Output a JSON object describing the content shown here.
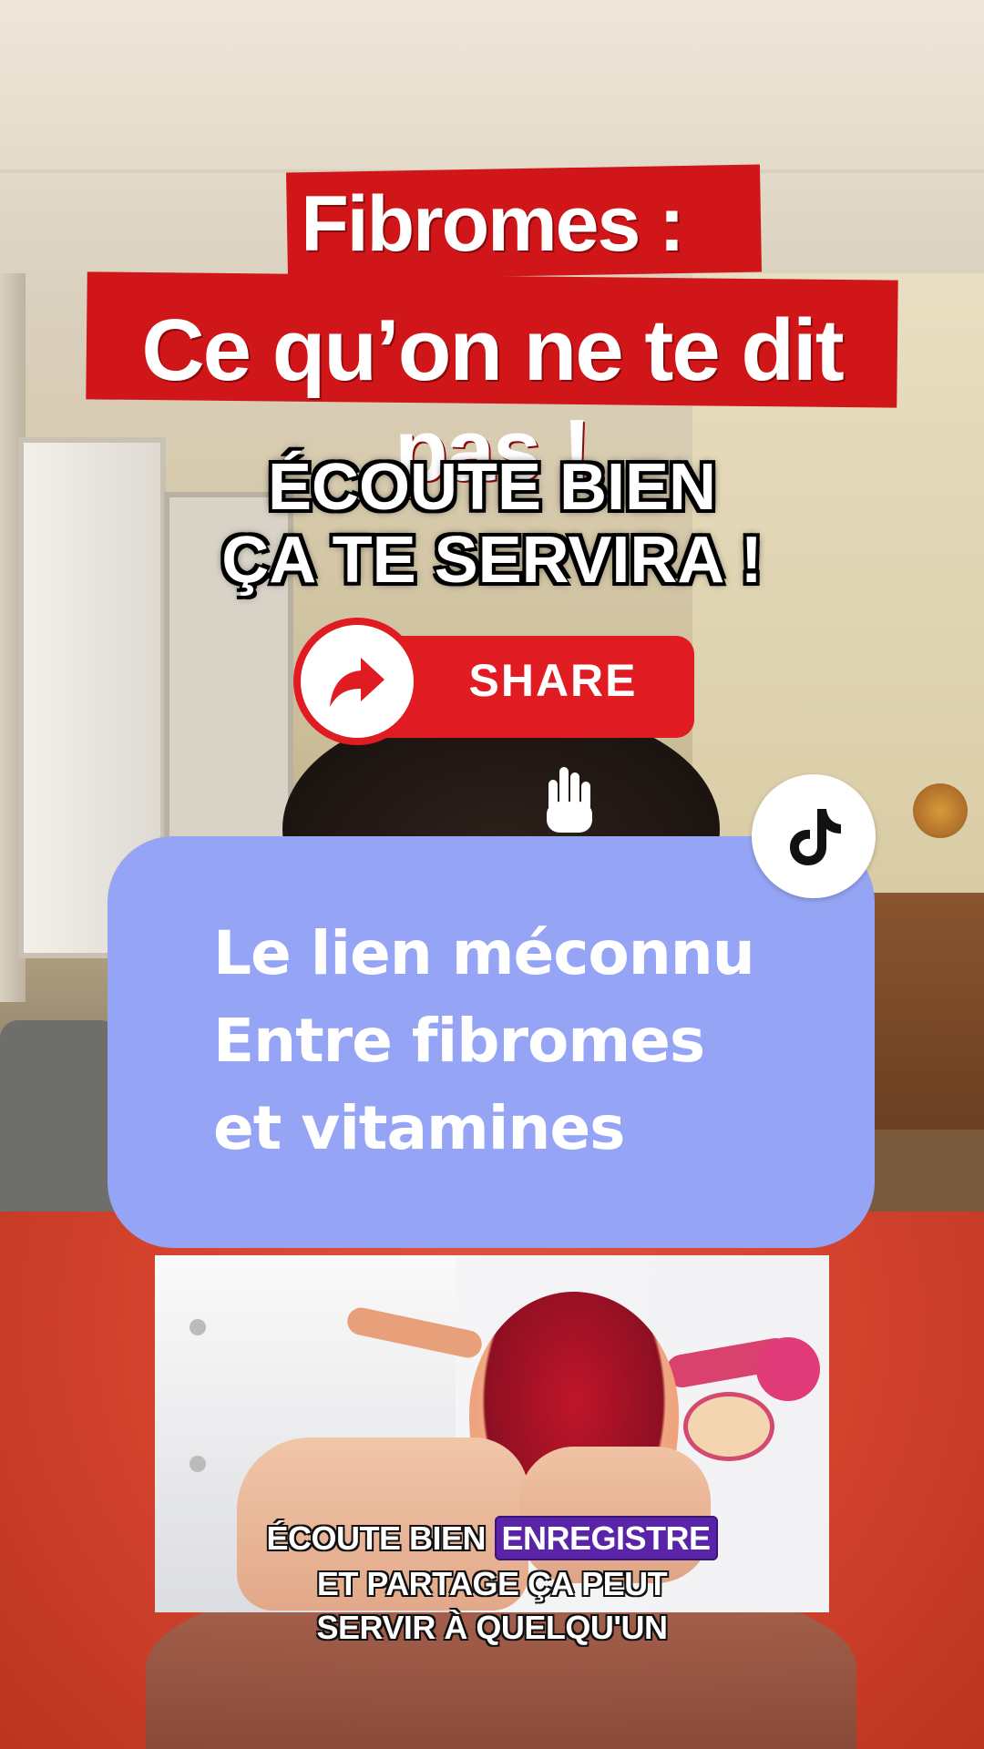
{
  "title": {
    "line1": "Fibromes :",
    "line2": "Ce qu’on ne te dit pas !"
  },
  "subtitle": {
    "line1": "ÉCOUTE BIEN",
    "line2": "ÇA TE SERVIRA !"
  },
  "share_button": {
    "label": "SHARE",
    "color": "#e01b22"
  },
  "card": {
    "line1": "Le lien méconnu",
    "line2": "Entre fibromes",
    "line3": "et vitamines",
    "background": "#96a4f5"
  },
  "icons": {
    "tiktok": "tiktok-logo-icon",
    "share": "share-arrow-icon",
    "hand": "pointing-hand-icon"
  },
  "caption": {
    "line1_a": "ÉCOUTE BIEN",
    "line1_highlight": "ENREGISTRE",
    "line2": "ET PARTAGE ÇA PEUT",
    "line3": "SERVIR À QUELQU'UN",
    "highlight_color": "#5a24a8"
  },
  "colors": {
    "title_red": "#d01619"
  }
}
